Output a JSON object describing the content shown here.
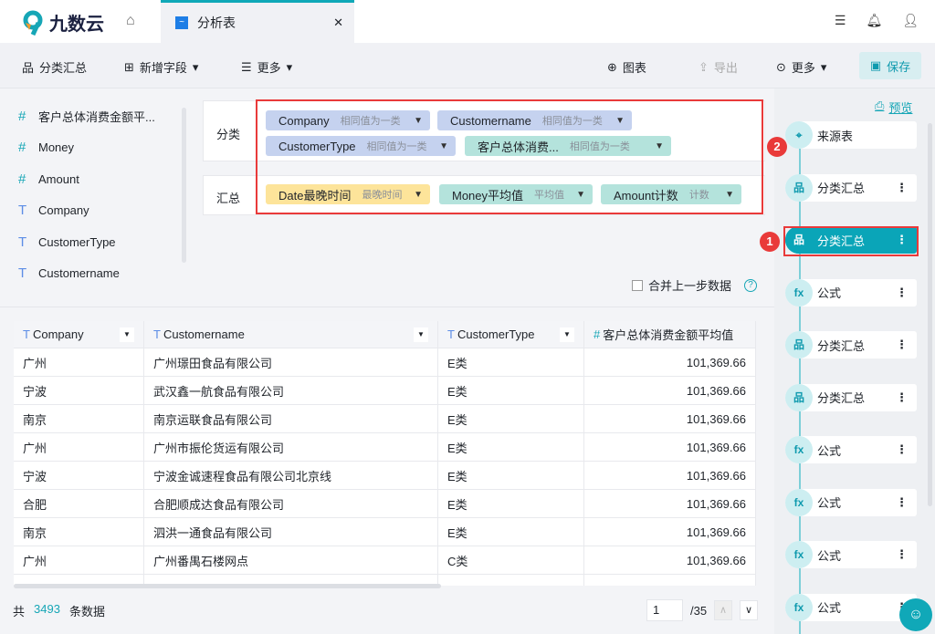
{
  "app": {
    "logo_text": "九数云",
    "tab_label": "分析表",
    "accent": "#10a8b8"
  },
  "toolbar": {
    "group_summary": "分类汇总",
    "add_field": "新增字段",
    "more": "更多",
    "chart": "图表",
    "export": "导出",
    "more2": "更多",
    "save": "保存"
  },
  "fields": [
    {
      "type": "number",
      "name": "客户总体消费金额平..."
    },
    {
      "type": "number",
      "name": "Money"
    },
    {
      "type": "number",
      "name": "Amount"
    },
    {
      "type": "text",
      "name": "Company"
    },
    {
      "type": "text",
      "name": "CustomerType"
    },
    {
      "type": "text",
      "name": "Customername"
    }
  ],
  "config": {
    "group_label": "分类",
    "summary_label": "汇总",
    "group_chips": [
      {
        "name": "Company",
        "mode": "相同值为一类"
      },
      {
        "name": "Customername",
        "mode": "相同值为一类"
      },
      {
        "name": "CustomerType",
        "mode": "相同值为一类"
      },
      {
        "name": "客户总体消费...",
        "mode": "相同值为一类"
      }
    ],
    "summary_chips": [
      {
        "name": "Date最晚时间",
        "mode": "最晚时间"
      },
      {
        "name": "Money平均值",
        "mode": "平均值"
      },
      {
        "name": "Amount计数",
        "mode": "计数"
      }
    ],
    "merge_label": "合并上一步数据",
    "merge_checked": false
  },
  "table": {
    "columns": [
      "Company",
      "Customername",
      "CustomerType",
      "客户总体消费金额平均值"
    ],
    "rows": [
      [
        "广州",
        "广州璟田食品有限公司",
        "E类",
        "101,369.66"
      ],
      [
        "宁波",
        "武汉鑫一航食品有限公司",
        "E类",
        "101,369.66"
      ],
      [
        "南京",
        "南京运联食品有限公司",
        "E类",
        "101,369.66"
      ],
      [
        "广州",
        "广州市振伦货运有限公司",
        "E类",
        "101,369.66"
      ],
      [
        "宁波",
        "宁波金诚速程食品有限公司北京线",
        "E类",
        "101,369.66"
      ],
      [
        "合肥",
        "合肥顺成达食品有限公司",
        "E类",
        "101,369.66"
      ],
      [
        "南京",
        "泗洪一通食品有限公司",
        "E类",
        "101,369.66"
      ],
      [
        "广州",
        "广州番禺石楼网点",
        "C类",
        "101,369.66"
      ]
    ]
  },
  "footer": {
    "prefix": "共",
    "count": "3493",
    "suffix": "条数据",
    "page": "1",
    "total_pages": "/35"
  },
  "steps": {
    "preview": "预览",
    "nodes": [
      {
        "icon": "source",
        "label": "来源表"
      },
      {
        "icon": "group",
        "label": "分类汇总"
      },
      {
        "icon": "group",
        "label": "分类汇总",
        "active": true
      },
      {
        "icon": "formula",
        "label": "公式"
      },
      {
        "icon": "group",
        "label": "分类汇总"
      },
      {
        "icon": "group",
        "label": "分类汇总"
      },
      {
        "icon": "formula",
        "label": "公式"
      },
      {
        "icon": "formula",
        "label": "公式"
      },
      {
        "icon": "formula",
        "label": "公式"
      },
      {
        "icon": "formula",
        "label": "公式"
      }
    ],
    "badges": [
      "1",
      "2"
    ]
  }
}
